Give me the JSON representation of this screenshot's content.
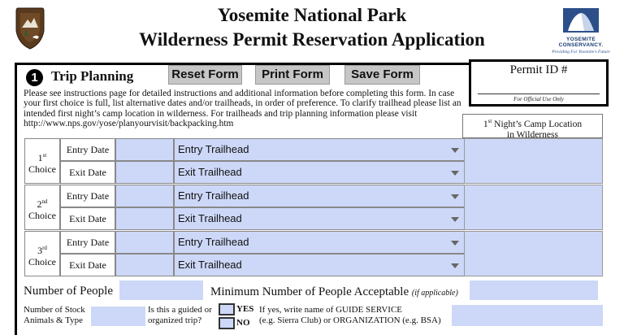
{
  "header": {
    "title_line1": "Yosemite National Park",
    "title_line2": "Wilderness Permit Reservation Application",
    "logo_right_name": "YOSEMITE CONSERVANCY.",
    "logo_right_tagline": "Providing For Yosemite's Future"
  },
  "section": {
    "number": "1",
    "title": "Trip Planning"
  },
  "toolbar": {
    "reset_label": "Reset Form",
    "print_label": "Print Form",
    "save_label": "Save Form"
  },
  "permit": {
    "label": "Permit ID #",
    "official_note": "For Official Use Only"
  },
  "instructions": "Please see instructions page for detailed instructions and additional information before completing this form. In case your first choice is full, list alternative dates and/or trailheads, in order of preference. To clarify trailhead please list an intended first night’s camp location in wilderness. For trailheads and trip planning information please visit http://www.nps.gov/yose/planyourvisit/backpacking.htm",
  "camp_header": {
    "ordinal_num": "1",
    "ordinal_suffix": "st",
    "text1": " Night’s Camp Location",
    "text2": "in Wilderness"
  },
  "choices": [
    {
      "num": "1",
      "suffix": "st",
      "word": "Choice",
      "entry_label": "Entry Date",
      "exit_label": "Exit Date",
      "entry_trailhead": "Entry Trailhead",
      "exit_trailhead": "Exit Trailhead"
    },
    {
      "num": "2",
      "suffix": "nd",
      "word": "Choice",
      "entry_label": "Entry Date",
      "exit_label": "Exit Date",
      "entry_trailhead": "Entry Trailhead",
      "exit_trailhead": "Exit Trailhead"
    },
    {
      "num": "3",
      "suffix": "rd",
      "word": "Choice",
      "entry_label": "Entry Date",
      "exit_label": "Exit Date",
      "entry_trailhead": "Entry Trailhead",
      "exit_trailhead": "Exit Trailhead"
    }
  ],
  "people": {
    "label": "Number of People",
    "min_label": "Minimum Number of People Acceptable",
    "if_applicable": "(if applicable)"
  },
  "stock": {
    "line1": "Number of Stock",
    "line2": "Animals & Type"
  },
  "guided": {
    "line1": "Is this a guided or",
    "line2": "organized trip?",
    "yes": "YES",
    "no": "NO"
  },
  "guide_service": {
    "line1": "If yes, write name of GUIDE SERVICE",
    "line2": "(e.g. Sierra Club) or ORGANIZATION (e.g. BSA)"
  },
  "colors": {
    "field_fill": "#cdd8f8",
    "button_fill": "#c6c6c6",
    "brand_blue": "#1b3a73"
  }
}
